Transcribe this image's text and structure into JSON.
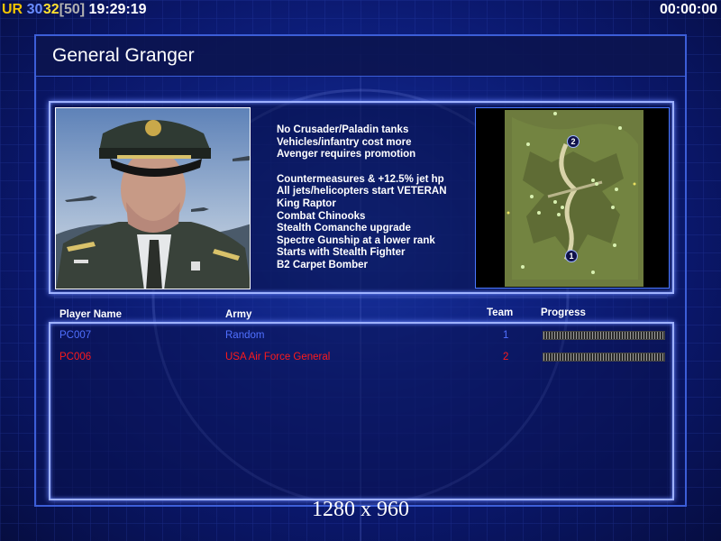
{
  "hud": {
    "rank": "UR",
    "fps": "30",
    "players": "32",
    "max_players": "[50]",
    "clock": "19:29:19",
    "timer": "00:00:00"
  },
  "general": {
    "name": "General Granger",
    "traits": [
      "No Crusader/Paladin tanks",
      "Vehicles/infantry cost more",
      "Avenger requires promotion",
      "Countermeasures & +12.5% jet hp",
      "All jets/helicopters start VETERAN",
      "King Raptor",
      "Combat Chinooks",
      "Stealth Comanche upgrade",
      "Spectre Gunship at a lower rank",
      "Starts with Stealth Fighter",
      "B2 Carpet Bomber"
    ]
  },
  "map": {
    "markers": [
      "2",
      "1"
    ]
  },
  "table": {
    "headers": {
      "player": "Player Name",
      "army": "Army",
      "team": "Team",
      "progress": "Progress"
    },
    "rows": [
      {
        "name": "PC007",
        "army": "Random",
        "team": "1",
        "progress": 1.0,
        "color": "#5070ff"
      },
      {
        "name": "PC006",
        "army": "USA Air Force General",
        "team": "2",
        "progress": 1.0,
        "color": "#ff1a1a"
      }
    ]
  },
  "footer": {
    "resolution": "1280 x 960"
  },
  "colors": {
    "hud_rank": "#f3c400",
    "hud_fps": "#6a8cff",
    "hud_players": "#ffe030",
    "hud_max": "#b0b0b0",
    "accent_border": "#9fb2ff"
  }
}
